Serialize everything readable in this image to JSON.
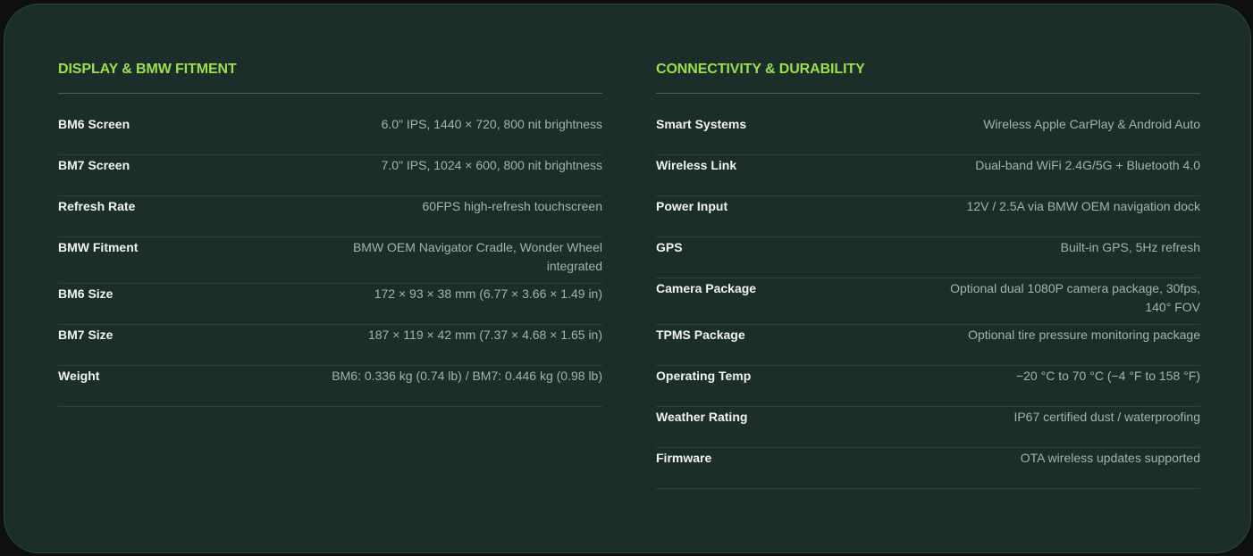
{
  "left": {
    "title": "DISPLAY & BMW FITMENT",
    "rows": [
      {
        "label": "BM6 Screen",
        "value": "6.0\" IPS, 1440 × 720, 800 nit brightness"
      },
      {
        "label": "BM7 Screen",
        "value": "7.0\" IPS, 1024 × 600, 800 nit brightness"
      },
      {
        "label": "Refresh Rate",
        "value": "60FPS high-refresh touchscreen"
      },
      {
        "label": "BMW Fitment",
        "value": "BMW OEM Navigator Cradle, Wonder Wheel integrated"
      },
      {
        "label": "BM6 Size",
        "value": "172 × 93 × 38 mm (6.77 × 3.66 × 1.49 in)"
      },
      {
        "label": "BM7 Size",
        "value": "187 × 119 × 42 mm (7.37 × 4.68 × 1.65 in)"
      },
      {
        "label": "Weight",
        "value": "BM6: 0.336 kg (0.74 lb) / BM7: 0.446 kg (0.98 lb)"
      }
    ]
  },
  "right": {
    "title": "CONNECTIVITY & DURABILITY",
    "rows": [
      {
        "label": "Smart Systems",
        "value": "Wireless Apple CarPlay & Android Auto"
      },
      {
        "label": "Wireless Link",
        "value": "Dual-band WiFi 2.4G/5G + Bluetooth 4.0"
      },
      {
        "label": "Power Input",
        "value": "12V / 2.5A via BMW OEM navigation dock"
      },
      {
        "label": "GPS",
        "value": "Built-in GPS, 5Hz refresh"
      },
      {
        "label": "Camera Package",
        "value": "Optional dual 1080P camera package, 30fps, 140° FOV"
      },
      {
        "label": "TPMS Package",
        "value": "Optional tire pressure monitoring package"
      },
      {
        "label": "Operating Temp",
        "value": "−20 °C to 70 °C (−4 °F to 158 °F)"
      },
      {
        "label": "Weather Rating",
        "value": "IP67 certified dust / waterproofing"
      },
      {
        "label": "Firmware",
        "value": "OTA wireless updates supported"
      }
    ]
  },
  "colors": {
    "panel_background": "#1b2e29",
    "accent_title": "#9be04b",
    "label_text": "#f3f5f2",
    "value_text": "#a5b3ad",
    "divider": "#2c423b"
  }
}
